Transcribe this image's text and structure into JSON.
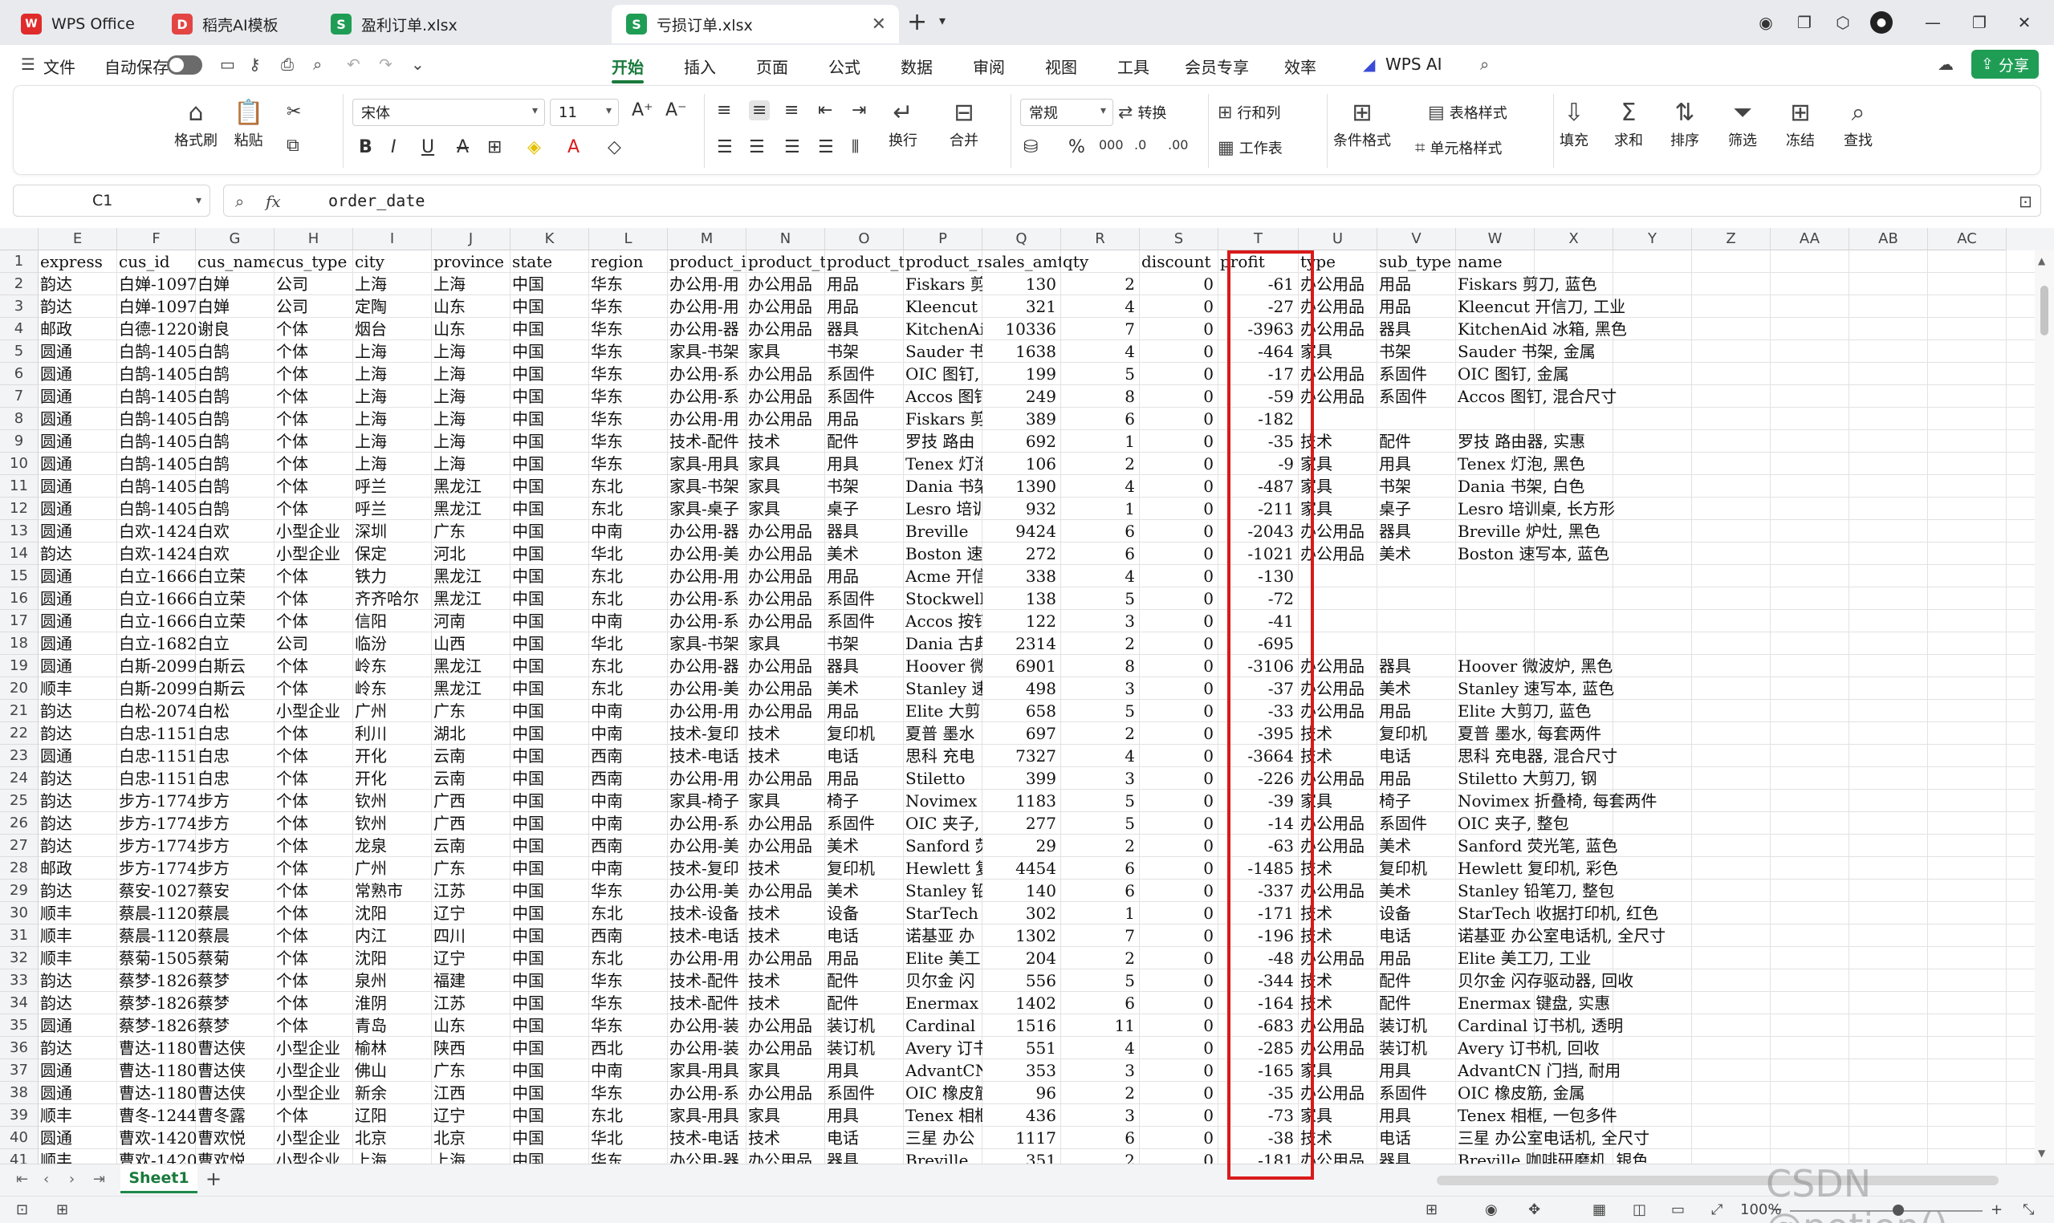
{
  "tabs": [
    {
      "label": "WPS Office",
      "icon": "wps-logo-icon",
      "color": "#e02b2b"
    },
    {
      "label": "稻壳AI模板",
      "icon": "docer-icon",
      "color": "#e34444"
    },
    {
      "label": "盈利订单.xlsx",
      "icon": "sheet-s-icon",
      "color": "#1f9d55"
    },
    {
      "label": "亏损订单.xlsx",
      "icon": "sheet-s-icon",
      "color": "#1f9d55"
    }
  ],
  "tab_icon_letter": "S",
  "tab_close": "✕",
  "tab_add": "+",
  "menu": {
    "file": "文件",
    "autosave": "自动保存",
    "items": [
      "开始",
      "插入",
      "页面",
      "公式",
      "数据",
      "审阅",
      "视图",
      "工具",
      "会员专享",
      "效率"
    ],
    "wps_ai": "WPS AI",
    "share": "分享"
  },
  "ribbon": {
    "format_painter": "格式刷",
    "paste": "粘贴",
    "font_name": "宋体",
    "font_size": "11",
    "number_format": "常规",
    "convert": "转换",
    "rows_cols": "行和列",
    "worksheet": "工作表",
    "wrap": "换行",
    "merge": "合并",
    "cond_format": "条件格式",
    "table_style": "表格样式",
    "cell_style": "单元格样式",
    "fill": "填充",
    "sum": "求和",
    "sort": "排序",
    "filter": "筛选",
    "freeze": "冻结",
    "find": "查找"
  },
  "formula_bar": {
    "cell_ref": "C1",
    "fx": "fx",
    "content": "order_date"
  },
  "columns": [
    "E",
    "F",
    "G",
    "H",
    "I",
    "J",
    "K",
    "L",
    "M",
    "N",
    "O",
    "P",
    "Q",
    "R",
    "S",
    "T",
    "U",
    "V",
    "W",
    "X",
    "Y",
    "Z",
    "AA",
    "AB",
    "AC"
  ],
  "header_row": [
    "express",
    "cus_id",
    "cus_name",
    "cus_type",
    "city",
    "province",
    "state",
    "region",
    "product_i",
    "product_t",
    "product_t",
    "product_r",
    "sales_amt",
    "qty",
    "discount",
    "profit",
    "type",
    "sub_type",
    "name"
  ],
  "rows": [
    [
      "韵达",
      "白婵-1097",
      "白婵",
      "公司",
      "上海",
      "上海",
      "中国",
      "华东",
      "办公用-用",
      "办公用品",
      "用品",
      "Fiskars 剪",
      "130",
      "2",
      "0",
      "-61",
      "办公用品",
      "用品",
      "Fiskars 剪刀, 蓝色"
    ],
    [
      "韵达",
      "白婵-1097",
      "白婵",
      "公司",
      "定陶",
      "山东",
      "中国",
      "华东",
      "办公用-用",
      "办公用品",
      "用品",
      "Kleencut",
      "321",
      "4",
      "0",
      "-27",
      "办公用品",
      "用品",
      "Kleencut 开信刀, 工业"
    ],
    [
      "邮政",
      "白德-1220",
      "谢良",
      "个体",
      "烟台",
      "山东",
      "中国",
      "华东",
      "办公用-器",
      "办公用品",
      "器具",
      "KitchenAi",
      "10336",
      "7",
      "0",
      "-3963",
      "办公用品",
      "器具",
      "KitchenAid 冰箱, 黑色"
    ],
    [
      "圆通",
      "白鹄-1405",
      "白鹄",
      "个体",
      "上海",
      "上海",
      "中国",
      "华东",
      "家具-书架",
      "家具",
      "书架",
      "Sauder 书",
      "1638",
      "4",
      "0",
      "-464",
      "家具",
      "书架",
      "Sauder 书架, 金属"
    ],
    [
      "圆通",
      "白鹄-1405",
      "白鹄",
      "个体",
      "上海",
      "上海",
      "中国",
      "华东",
      "办公用-系",
      "办公用品",
      "系固件",
      "OIC 图钉,",
      "199",
      "5",
      "0",
      "-17",
      "办公用品",
      "系固件",
      "OIC 图钉, 金属"
    ],
    [
      "圆通",
      "白鹄-1405",
      "白鹄",
      "个体",
      "上海",
      "上海",
      "中国",
      "华东",
      "办公用-系",
      "办公用品",
      "系固件",
      "Accos 图钉",
      "249",
      "8",
      "0",
      "-59",
      "办公用品",
      "系固件",
      "Accos 图钉, 混合尺寸"
    ],
    [
      "圆通",
      "白鹄-1405",
      "白鹄",
      "个体",
      "上海",
      "上海",
      "中国",
      "华东",
      "办公用-用",
      "办公用品",
      "用品",
      "Fiskars 剪",
      "389",
      "6",
      "0",
      "-182",
      "",
      "",
      ""
    ],
    [
      "圆通",
      "白鹄-1405",
      "白鹄",
      "个体",
      "上海",
      "上海",
      "中国",
      "华东",
      "技术-配件",
      "技术",
      "配件",
      "罗技 路由",
      "692",
      "1",
      "0",
      "-35",
      "技术",
      "配件",
      "罗技 路由器, 实惠"
    ],
    [
      "圆通",
      "白鹄-1405",
      "白鹄",
      "个体",
      "上海",
      "上海",
      "中国",
      "华东",
      "家具-用具",
      "家具",
      "用具",
      "Tenex 灯泡",
      "106",
      "2",
      "0",
      "-9",
      "家具",
      "用具",
      "Tenex 灯泡, 黑色"
    ],
    [
      "圆通",
      "白鹄-1405",
      "白鹄",
      "个体",
      "呼兰",
      "黑龙江",
      "中国",
      "东北",
      "家具-书架",
      "家具",
      "书架",
      "Dania 书架",
      "1390",
      "4",
      "0",
      "-487",
      "家具",
      "书架",
      "Dania 书架, 白色"
    ],
    [
      "圆通",
      "白鹄-1405",
      "白鹄",
      "个体",
      "呼兰",
      "黑龙江",
      "中国",
      "东北",
      "家具-桌子",
      "家具",
      "桌子",
      "Lesro 培训",
      "932",
      "1",
      "0",
      "-211",
      "家具",
      "桌子",
      "Lesro 培训桌, 长方形"
    ],
    [
      "圆通",
      "白欢-1424",
      "白欢",
      "小型企业",
      "深圳",
      "广东",
      "中国",
      "中南",
      "办公用-器",
      "办公用品",
      "器具",
      "Breville",
      "9424",
      "6",
      "0",
      "-2043",
      "办公用品",
      "器具",
      "Breville 炉灶, 黑色"
    ],
    [
      "韵达",
      "白欢-1424",
      "白欢",
      "小型企业",
      "保定",
      "河北",
      "中国",
      "华北",
      "办公用-美",
      "办公用品",
      "美术",
      "Boston 速",
      "272",
      "6",
      "0",
      "-1021",
      "办公用品",
      "美术",
      "Boston 速写本, 蓝色"
    ],
    [
      "圆通",
      "白立-1666",
      "白立荣",
      "个体",
      "铁力",
      "黑龙江",
      "中国",
      "东北",
      "办公用-用",
      "办公用品",
      "用品",
      "Acme 开信",
      "338",
      "4",
      "0",
      "-130",
      "",
      "",
      ""
    ],
    [
      "圆通",
      "白立-1666",
      "白立荣",
      "个体",
      "齐齐哈尔",
      "黑龙江",
      "中国",
      "东北",
      "办公用-系",
      "办公用品",
      "系固件",
      "Stockwell",
      "138",
      "5",
      "0",
      "-72",
      "",
      "",
      ""
    ],
    [
      "圆通",
      "白立-1666",
      "白立荣",
      "个体",
      "信阳",
      "河南",
      "中国",
      "中南",
      "办公用-系",
      "办公用品",
      "系固件",
      "Accos 按钉",
      "122",
      "3",
      "0",
      "-41",
      "",
      "",
      ""
    ],
    [
      "圆通",
      "白立-1682",
      "白立",
      "公司",
      "临汾",
      "山西",
      "中国",
      "华北",
      "家具-书架",
      "家具",
      "书架",
      "Dania 古典",
      "2314",
      "2",
      "0",
      "-695",
      "",
      "",
      ""
    ],
    [
      "圆通",
      "白斯-2099",
      "白斯云",
      "个体",
      "岭东",
      "黑龙江",
      "中国",
      "东北",
      "办公用-器",
      "办公用品",
      "器具",
      "Hoover 微",
      "6901",
      "8",
      "0",
      "-3106",
      "办公用品",
      "器具",
      "Hoover 微波炉, 黑色"
    ],
    [
      "顺丰",
      "白斯-2099",
      "白斯云",
      "个体",
      "岭东",
      "黑龙江",
      "中国",
      "东北",
      "办公用-美",
      "办公用品",
      "美术",
      "Stanley 速",
      "498",
      "3",
      "0",
      "-37",
      "办公用品",
      "美术",
      "Stanley 速写本, 蓝色"
    ],
    [
      "韵达",
      "白松-2074",
      "白松",
      "小型企业",
      "广州",
      "广东",
      "中国",
      "中南",
      "办公用-用",
      "办公用品",
      "用品",
      "Elite 大剪",
      "658",
      "5",
      "0",
      "-33",
      "办公用品",
      "用品",
      "Elite 大剪刀, 蓝色"
    ],
    [
      "韵达",
      "白忠-1151",
      "白忠",
      "个体",
      "利川",
      "湖北",
      "中国",
      "中南",
      "技术-复印",
      "技术",
      "复印机",
      "夏普 墨水",
      "697",
      "2",
      "0",
      "-395",
      "技术",
      "复印机",
      "夏普 墨水, 每套两件"
    ],
    [
      "圆通",
      "白忠-1151",
      "白忠",
      "个体",
      "开化",
      "云南",
      "中国",
      "西南",
      "技术-电话",
      "技术",
      "电话",
      "思科 充电",
      "7327",
      "4",
      "0",
      "-3664",
      "技术",
      "电话",
      "思科 充电器, 混合尺寸"
    ],
    [
      "韵达",
      "白忠-1151",
      "白忠",
      "个体",
      "开化",
      "云南",
      "中国",
      "西南",
      "办公用-用",
      "办公用品",
      "用品",
      "Stiletto",
      "399",
      "3",
      "0",
      "-226",
      "办公用品",
      "用品",
      "Stiletto 大剪刀, 钢"
    ],
    [
      "韵达",
      "步方-1774",
      "步方",
      "个体",
      "钦州",
      "广西",
      "中国",
      "中南",
      "家具-椅子",
      "家具",
      "椅子",
      "Novimex 折",
      "1183",
      "5",
      "0",
      "-39",
      "家具",
      "椅子",
      "Novimex 折叠椅, 每套两件"
    ],
    [
      "韵达",
      "步方-1774",
      "步方",
      "个体",
      "钦州",
      "广西",
      "中国",
      "中南",
      "办公用-系",
      "办公用品",
      "系固件",
      "OIC 夹子,",
      "277",
      "5",
      "0",
      "-14",
      "办公用品",
      "系固件",
      "OIC 夹子, 整包"
    ],
    [
      "韵达",
      "步方-1774",
      "步方",
      "个体",
      "龙泉",
      "云南",
      "中国",
      "西南",
      "办公用-美",
      "办公用品",
      "美术",
      "Sanford 荧",
      "29",
      "2",
      "0",
      "-63",
      "办公用品",
      "美术",
      "Sanford 荧光笔, 蓝色"
    ],
    [
      "邮政",
      "步方-1774",
      "步方",
      "个体",
      "广州",
      "广东",
      "中国",
      "中南",
      "技术-复印",
      "技术",
      "复印机",
      "Hewlett 复",
      "4454",
      "6",
      "0",
      "-1485",
      "技术",
      "复印机",
      "Hewlett 复印机, 彩色"
    ],
    [
      "韵达",
      "蔡安-1027",
      "蔡安",
      "个体",
      "常熟市",
      "江苏",
      "中国",
      "华东",
      "办公用-美",
      "办公用品",
      "美术",
      "Stanley 铅",
      "140",
      "6",
      "0",
      "-337",
      "办公用品",
      "美术",
      "Stanley 铅笔刀, 整包"
    ],
    [
      "顺丰",
      "蔡晨-1120",
      "蔡晨",
      "个体",
      "沈阳",
      "辽宁",
      "中国",
      "东北",
      "技术-设备",
      "技术",
      "设备",
      "StarTech",
      "302",
      "1",
      "0",
      "-171",
      "技术",
      "设备",
      "StarTech 收据打印机, 红色"
    ],
    [
      "顺丰",
      "蔡晨-1120",
      "蔡晨",
      "个体",
      "内江",
      "四川",
      "中国",
      "西南",
      "技术-电话",
      "技术",
      "电话",
      "诺基亚 办",
      "1302",
      "7",
      "0",
      "-196",
      "技术",
      "电话",
      "诺基亚 办公室电话机, 全尺寸"
    ],
    [
      "顺丰",
      "蔡菊-1505",
      "蔡菊",
      "个体",
      "沈阳",
      "辽宁",
      "中国",
      "东北",
      "办公用-用",
      "办公用品",
      "用品",
      "Elite 美工",
      "204",
      "2",
      "0",
      "-48",
      "办公用品",
      "用品",
      "Elite 美工刀, 工业"
    ],
    [
      "韵达",
      "蔡梦-1826",
      "蔡梦",
      "个体",
      "泉州",
      "福建",
      "中国",
      "华东",
      "技术-配件",
      "技术",
      "配件",
      "贝尔金 闪",
      "556",
      "5",
      "0",
      "-344",
      "技术",
      "配件",
      "贝尔金 闪存驱动器, 回收"
    ],
    [
      "韵达",
      "蔡梦-1826",
      "蔡梦",
      "个体",
      "淮阴",
      "江苏",
      "中国",
      "华东",
      "技术-配件",
      "技术",
      "配件",
      "Enermax 键",
      "1402",
      "6",
      "0",
      "-164",
      "技术",
      "配件",
      "Enermax 键盘, 实惠"
    ],
    [
      "圆通",
      "蔡梦-1826",
      "蔡梦",
      "个体",
      "青岛",
      "山东",
      "中国",
      "华东",
      "办公用-装",
      "办公用品",
      "装订机",
      "Cardinal",
      "1516",
      "11",
      "0",
      "-683",
      "办公用品",
      "装订机",
      "Cardinal 订书机, 透明"
    ],
    [
      "韵达",
      "曹达-1180",
      "曹达侠",
      "小型企业",
      "榆林",
      "陕西",
      "中国",
      "西北",
      "办公用-装",
      "办公用品",
      "装订机",
      "Avery 订书",
      "551",
      "4",
      "0",
      "-285",
      "办公用品",
      "装订机",
      "Avery 订书机, 回收"
    ],
    [
      "圆通",
      "曹达-1180",
      "曹达侠",
      "小型企业",
      "佛山",
      "广东",
      "中国",
      "中南",
      "家具-用具",
      "家具",
      "用具",
      "AdvantCN",
      "353",
      "3",
      "0",
      "-165",
      "家具",
      "用具",
      "AdvantCN 门挡, 耐用"
    ],
    [
      "圆通",
      "曹达-1180",
      "曹达侠",
      "小型企业",
      "新余",
      "江西",
      "中国",
      "华东",
      "办公用-系",
      "办公用品",
      "系固件",
      "OIC 橡皮筋",
      "96",
      "2",
      "0",
      "-35",
      "办公用品",
      "系固件",
      "OIC 橡皮筋, 金属"
    ],
    [
      "顺丰",
      "曹冬-1244",
      "曹冬露",
      "个体",
      "辽阳",
      "辽宁",
      "中国",
      "东北",
      "家具-用具",
      "家具",
      "用具",
      "Tenex 相框",
      "436",
      "3",
      "0",
      "-73",
      "家具",
      "用具",
      "Tenex 相框, 一包多件"
    ],
    [
      "圆通",
      "曹欢-1420",
      "曹欢悦",
      "小型企业",
      "北京",
      "北京",
      "中国",
      "华北",
      "技术-电话",
      "技术",
      "电话",
      "三星 办公",
      "1117",
      "6",
      "0",
      "-38",
      "技术",
      "电话",
      "三星 办公室电话机, 全尺寸"
    ],
    [
      "顺丰",
      "曹欢-1420",
      "曹欢悦",
      "小型企业",
      "上海",
      "上海",
      "中国",
      "华东",
      "办公用-器",
      "办公用品",
      "器具",
      "Breville",
      "351",
      "2",
      "0",
      "-181",
      "办公用品",
      "器具",
      "Breville 咖啡研磨机, 银色"
    ]
  ],
  "sheet": {
    "name": "Sheet1",
    "add": "+"
  },
  "status": {
    "zoom": "100%"
  },
  "watermark": "CSDN @potion()"
}
